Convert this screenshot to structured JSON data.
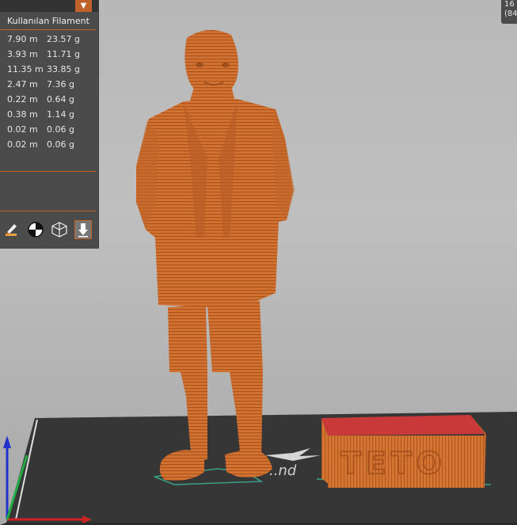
{
  "panel": {
    "header": "Kullanılan Filament",
    "dropdown_icon": "chevron-down-icon",
    "rows": [
      {
        "length": "7.90 m",
        "weight": "23.57 g"
      },
      {
        "length": "3.93 m",
        "weight": "11.71 g"
      },
      {
        "length": "11.35 m",
        "weight": "33.85 g"
      },
      {
        "length": "2.47 m",
        "weight": "7.36 g"
      },
      {
        "length": "0.22 m",
        "weight": "0.64 g"
      },
      {
        "length": "0.38 m",
        "weight": "1.14 g"
      },
      {
        "length": "0.02 m",
        "weight": "0.06 g"
      },
      {
        "length": "0.02 m",
        "weight": "0.06 g"
      }
    ],
    "tools": [
      "paint-brush-icon",
      "center-target-icon",
      "wireframe-cube-icon",
      "download-arrow-icon"
    ]
  },
  "corner": {
    "line1": "16",
    "line2": "(84"
  },
  "scene": {
    "model_color": "#d2702f",
    "box_top_color": "#c9393a",
    "plate_color": "#3a3a3a",
    "accent": "#c0612a"
  }
}
